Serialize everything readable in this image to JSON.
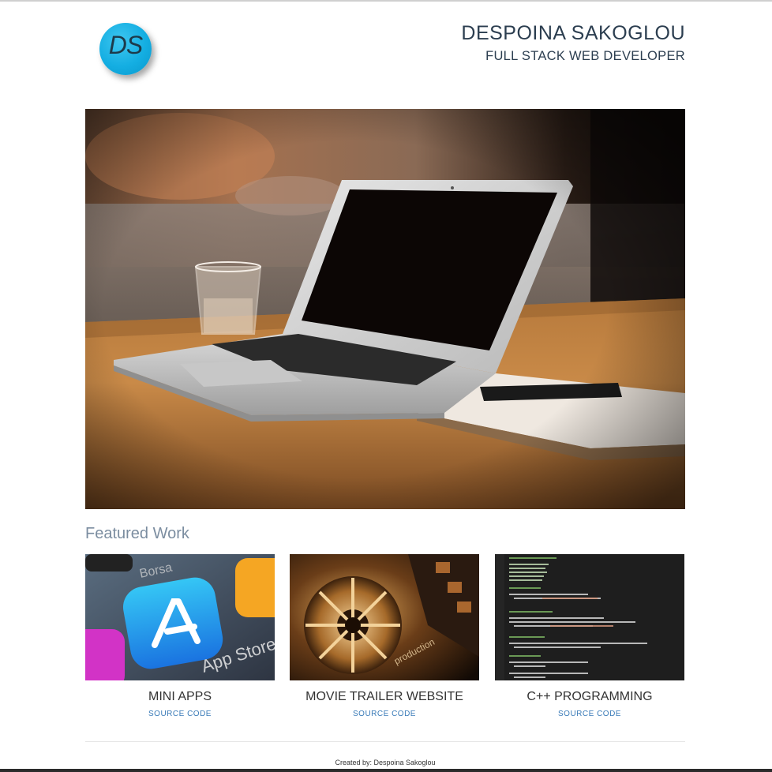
{
  "header": {
    "logo_text": "DS",
    "name": "DESPOINA SAKOGLOU",
    "role": "FULL STACK WEB DEVELOPER"
  },
  "hero": {
    "icon": "laptop-on-desk-photo"
  },
  "featured": {
    "title": "Featured Work",
    "cards": [
      {
        "title": "MINI APPS",
        "link": "SOURCE CODE",
        "icon": "app-store-photo"
      },
      {
        "title": "MOVIE TRAILER WEBSITE",
        "link": "SOURCE CODE",
        "icon": "film-reel-photo"
      },
      {
        "title": "C++ PROGRAMMING",
        "link": "SOURCE CODE",
        "icon": "code-editor-photo"
      }
    ]
  },
  "footer": {
    "text": "Created by: Despoina Sakoglou"
  },
  "colors": {
    "accent": "#14aee2",
    "link": "#3a7bb8",
    "heading": "#2c3e50",
    "featured_title": "#7b8da0"
  }
}
